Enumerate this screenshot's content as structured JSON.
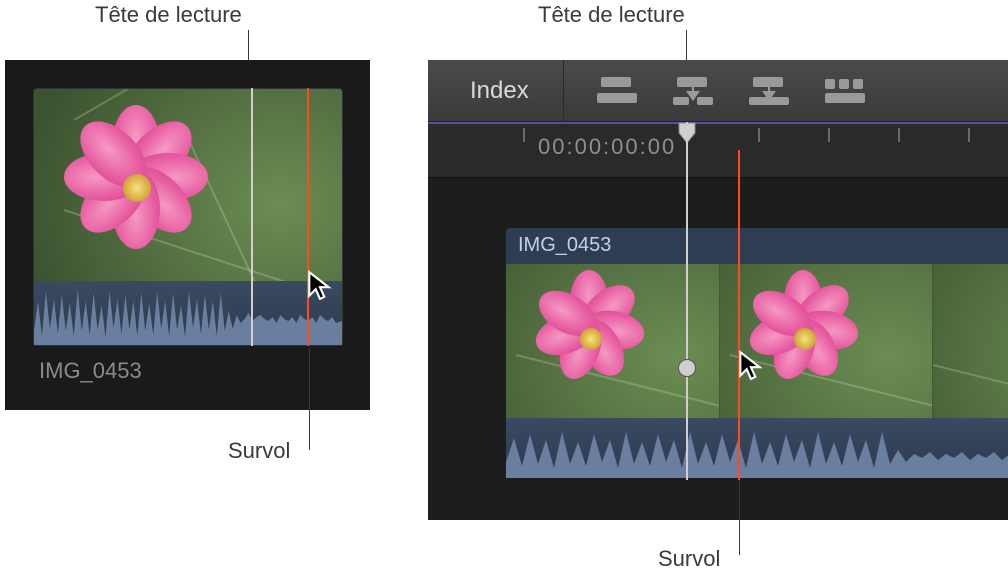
{
  "callouts": {
    "playhead_left": "Tête de lecture",
    "skimmer_left": "Survol",
    "playhead_right": "Tête de lecture",
    "skimmer_right": "Survol"
  },
  "browser": {
    "clip_name": "IMG_0453"
  },
  "timeline": {
    "index_button": "Index",
    "timecode": "00:00:00:00",
    "clip_name": "IMG_0453",
    "toolbar_icons": [
      "insert-clip-icon",
      "append-clip-icon",
      "connect-clip-icon",
      "overwrite-clip-icon"
    ]
  },
  "colors": {
    "playhead": "#cfcfcf",
    "skimmer": "#ff4a1a",
    "panel_bg": "#1a1a1a",
    "toolbar_bg": "#424242",
    "clip_header": "#2e3d52",
    "audio_bg": "#33425a"
  }
}
